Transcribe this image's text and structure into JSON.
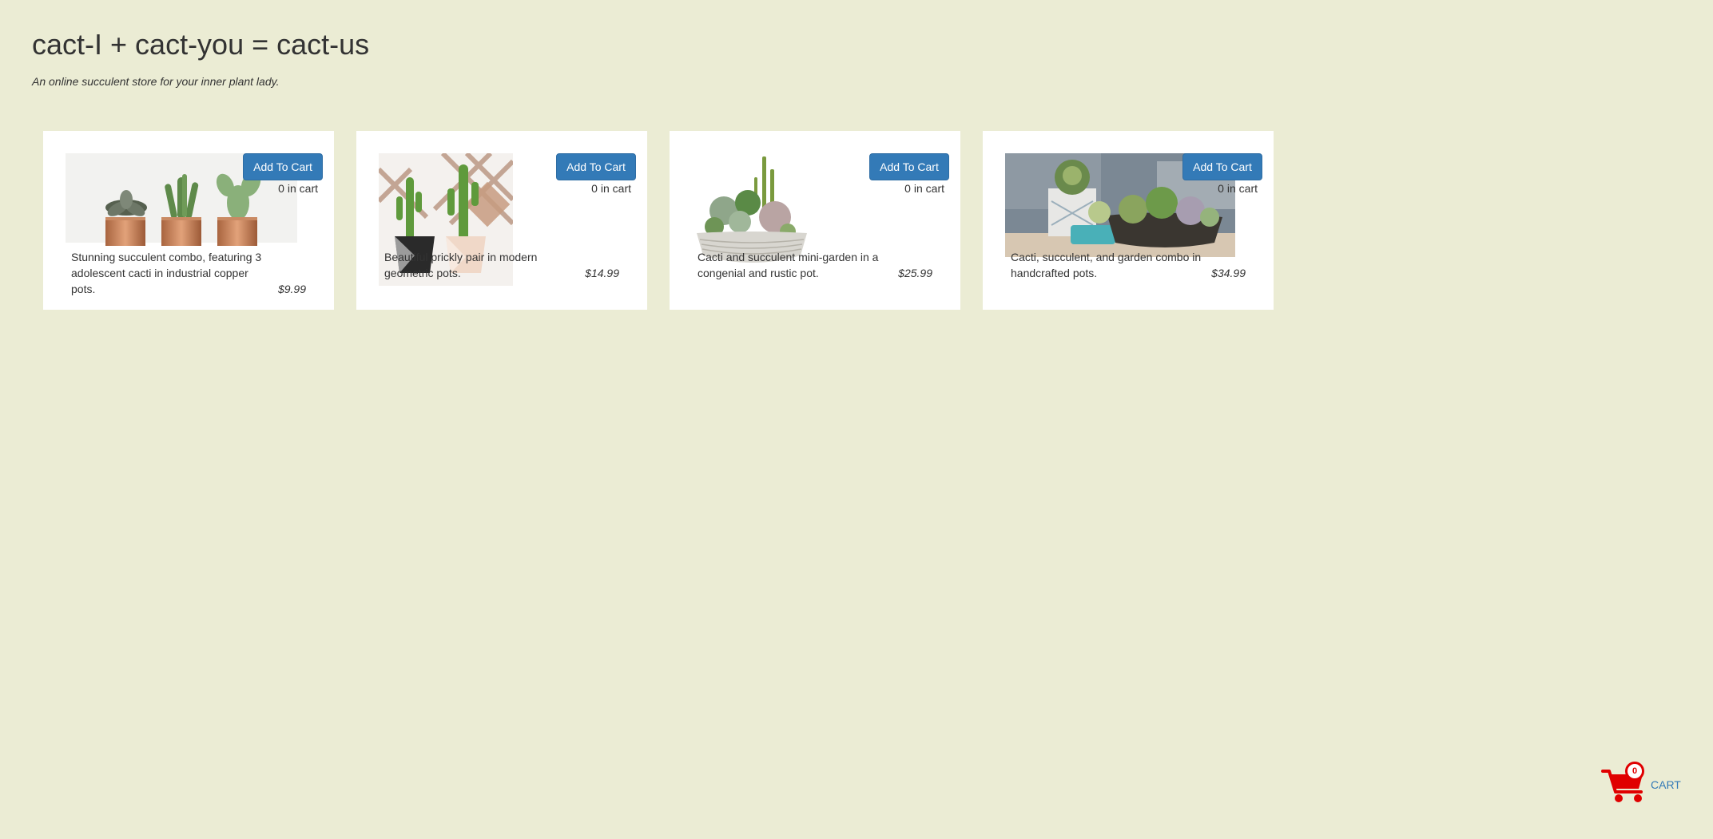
{
  "header": {
    "title": "cact-I + cact-you = cact-us",
    "tagline": "An online succulent store for your inner plant lady."
  },
  "products": [
    {
      "add_label": "Add To Cart",
      "cart_count": "0",
      "in_cart_suffix": "in cart",
      "description": "Stunning succulent combo, featuring 3 adolescent cacti in industrial copper pots.",
      "price": "$9.99"
    },
    {
      "add_label": "Add To Cart",
      "cart_count": "0",
      "in_cart_suffix": "in cart",
      "description": "Beautiful prickly pair in modern geometric pots.",
      "price": "$14.99"
    },
    {
      "add_label": "Add To Cart",
      "cart_count": "0",
      "in_cart_suffix": "in cart",
      "description": "Cacti and succulent mini-garden in a congenial and rustic pot.",
      "price": "$25.99"
    },
    {
      "add_label": "Add To Cart",
      "cart_count": "0",
      "in_cart_suffix": "in cart",
      "description": "Cacti, succulent, and garden combo in handcrafted pots.",
      "price": "$34.99"
    }
  ],
  "cart": {
    "count": "0",
    "label": "CART",
    "icon": "shopping-cart-icon"
  },
  "colors": {
    "page_background": "#ebecd4",
    "button": "#337ab7",
    "cart_icon": "#e00000",
    "link": "#337ab7"
  }
}
